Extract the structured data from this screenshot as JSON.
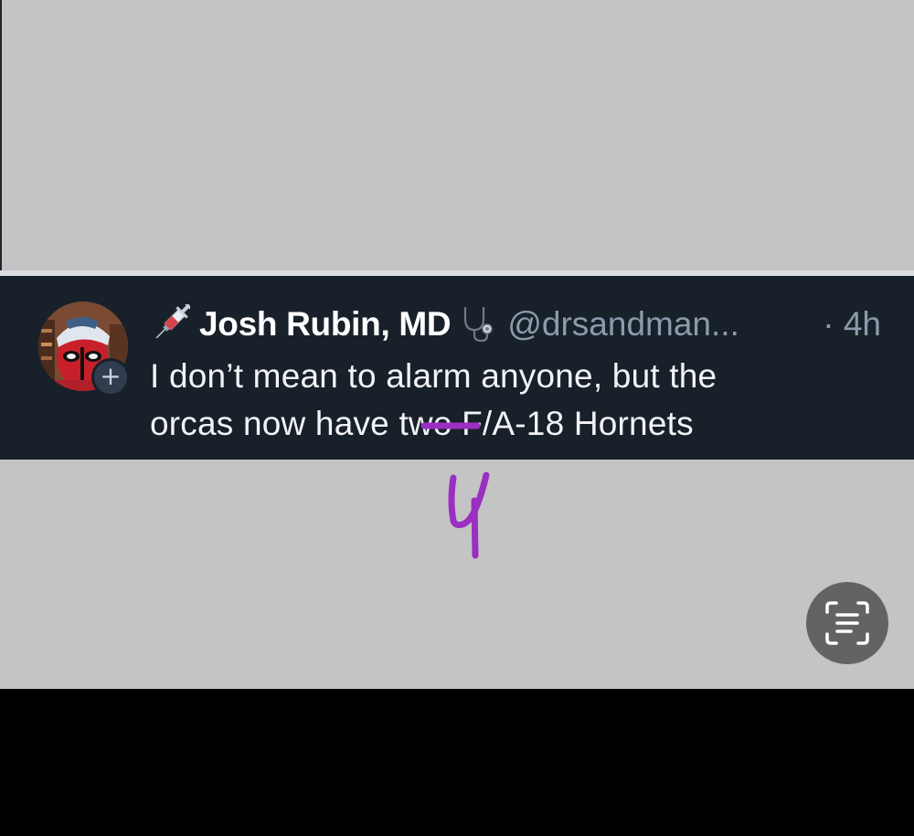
{
  "post": {
    "display_name": "Josh Rubin, MD",
    "handle": "@drsandman...",
    "time": "· 4h",
    "text_line1": "I don’t mean to alarm anyone, but the",
    "text_prefix": "orcas now have ",
    "text_struck": "two",
    "text_suffix": " F/A-18 Hornets",
    "avatar_add_label": "+"
  },
  "annotation": {
    "handwritten_number": "4",
    "color": "#9b2fc2"
  },
  "icons": {
    "name_prefix": "syringe-icon",
    "name_suffix": "stethoscope-icon",
    "avatar_badge": "plus-icon",
    "fab": "text-scan-icon"
  },
  "colors": {
    "post_background": "#18202a",
    "page_gray": "#c4c4c4",
    "handle": "#8b9bac",
    "fab_background": "#636363"
  }
}
